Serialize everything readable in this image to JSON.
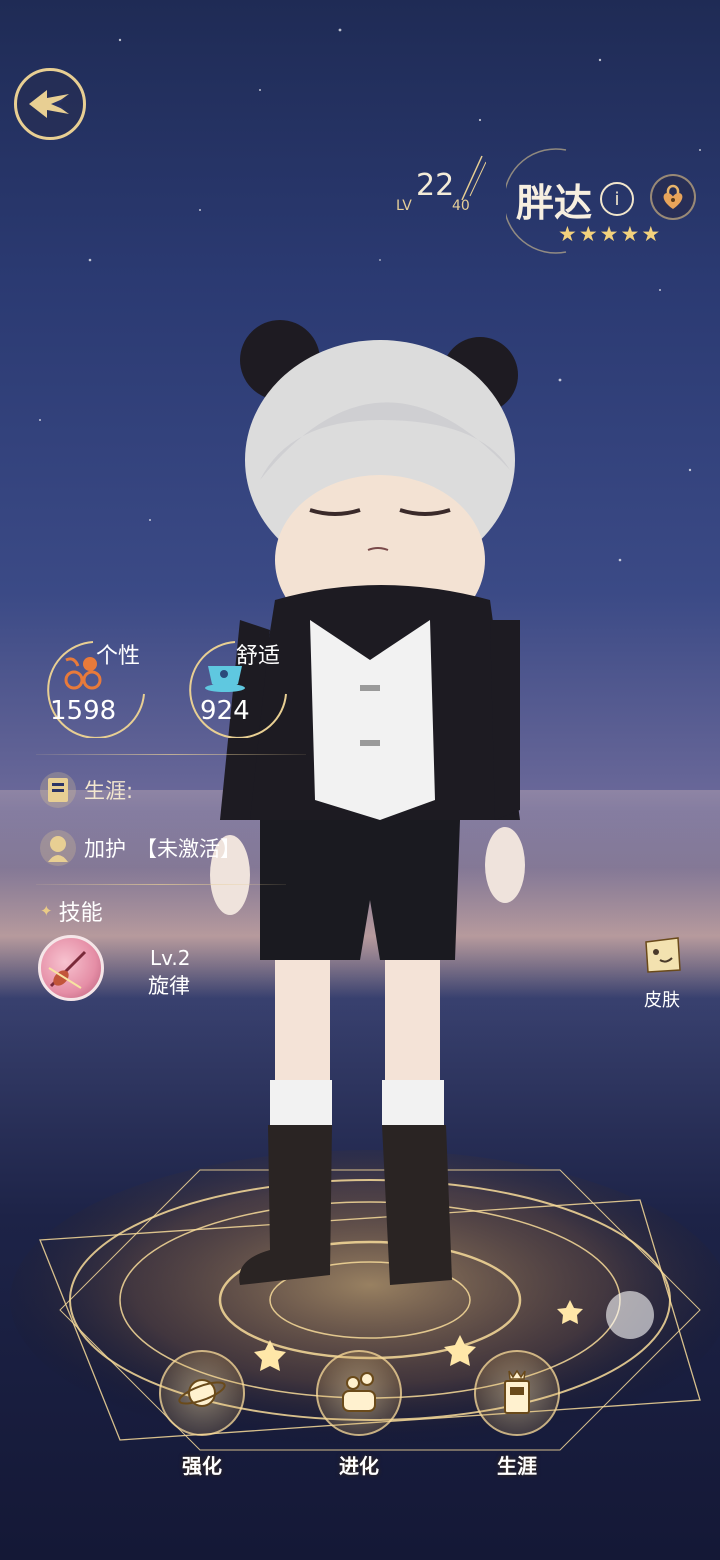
{
  "header": {
    "level_current": "22",
    "level_prefix": "LV",
    "level_max": "40",
    "character_name": "胖达",
    "edit_icon_glyph": "i",
    "star_count": 5,
    "star_glyph": "★"
  },
  "stats": {
    "personality_label": "个性",
    "personality_value": "1598",
    "comfort_label": "舒适",
    "comfort_value": "924"
  },
  "info": {
    "career_label": "生涯:",
    "protection_label": "加护",
    "protection_status": "【未激活】"
  },
  "skills": {
    "title_glyph": "✦",
    "title": "技能",
    "skill_level": "Lv.2",
    "skill_name": "旋律"
  },
  "side": {
    "skin_label": "皮肤"
  },
  "bottom_nav": {
    "enhance_label": "强化",
    "evolve_label": "进化",
    "career_label": "生涯"
  },
  "colors": {
    "gold_accent": "#e8cf93",
    "star_gold": "#f3d27d",
    "personality_icon": "#e87a3a",
    "comfort_icon": "#5fc8e0"
  }
}
